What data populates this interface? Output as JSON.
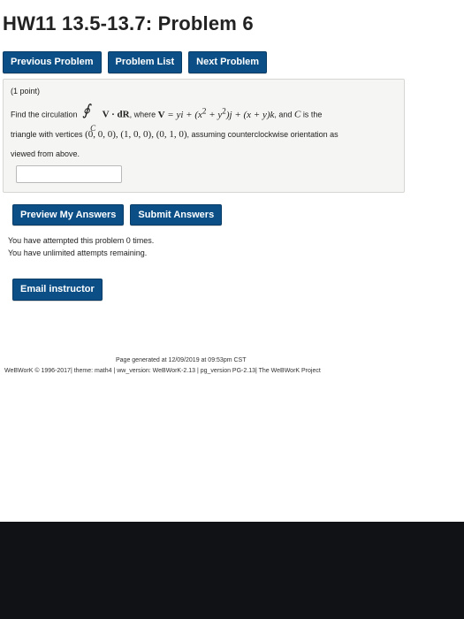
{
  "page": {
    "title": "HW11 13.5-13.7: Problem 6"
  },
  "nav": {
    "previous": "Previous Problem",
    "list": "Problem List",
    "next": "Next Problem"
  },
  "problem": {
    "points": "(1 point)",
    "text_before": "Find the circulation",
    "integral_sub": "C",
    "integrand": "V · dR",
    "where": ", where",
    "field_lhs": "V",
    "field_rhs_a": "= yi + (x",
    "field_rhs_b": "+ y",
    "field_rhs_c": ")j + (x + y)k",
    "exp2": "2",
    "and": ", and",
    "curve": "C",
    "is_the": "is the",
    "line2": "triangle with vertices",
    "vertices": "(0, 0, 0), (1, 0, 0), (0, 1, 0)",
    "line2_rest": ", assuming counterclockwise orientation as",
    "line3": "viewed from above.",
    "answer_value": ""
  },
  "actions": {
    "preview": "Preview My Answers",
    "submit": "Submit Answers"
  },
  "status": {
    "attempts": "You have attempted this problem 0 times.",
    "remaining": "You have unlimited attempts remaining."
  },
  "email": {
    "label": "Email instructor"
  },
  "footer": {
    "generated": "Page generated at 12/09/2019 at 09:53pm CST",
    "credits": "WeBWorK © 1996-2017| theme: math4 | ww_version: WeBWorK-2.13 | pg_version PG-2.13| The WeBWorK Project"
  },
  "colors": {
    "button_bg": "#0b4f86",
    "panel_bg": "#f5f5f3",
    "dark_band": "#111216"
  }
}
